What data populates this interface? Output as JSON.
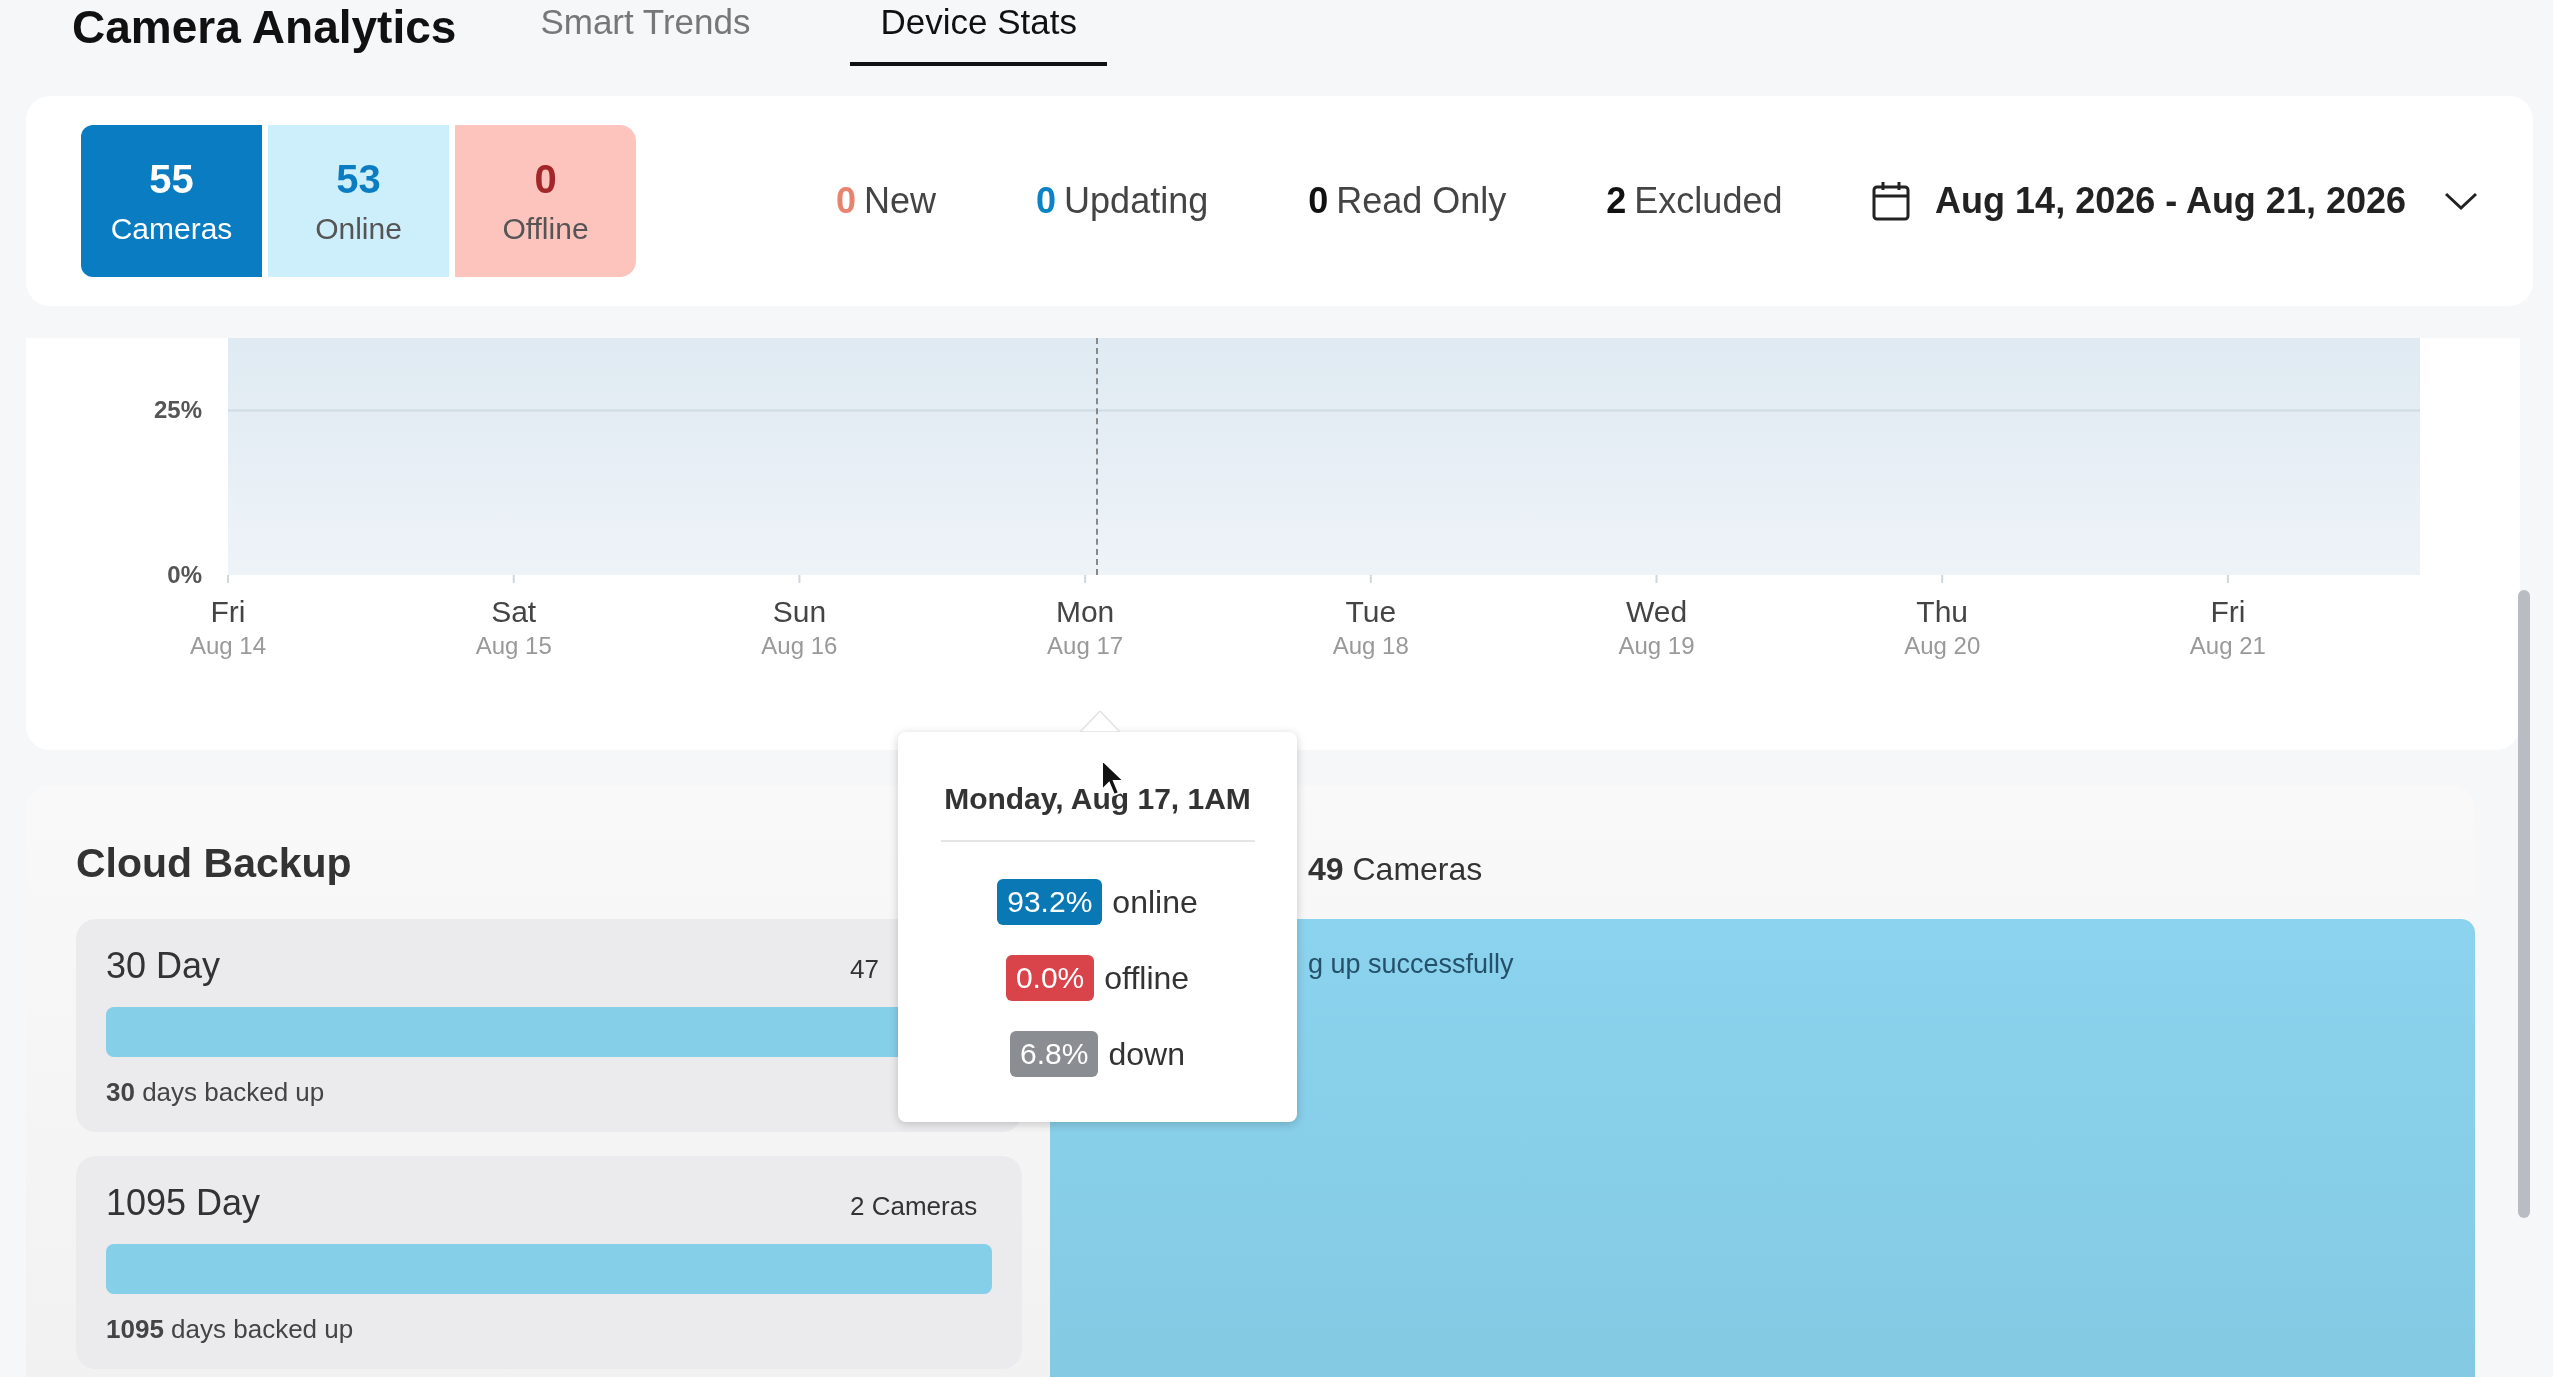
{
  "header": {
    "title": "Camera Analytics"
  },
  "tabs": [
    {
      "label": "Smart Trends",
      "selected": false
    },
    {
      "label": "Device Stats",
      "selected": true
    }
  ],
  "summary": {
    "tiles": [
      {
        "kind": "total",
        "value": "55",
        "label": "Cameras"
      },
      {
        "kind": "online",
        "value": "53",
        "label": "Online"
      },
      {
        "kind": "offline",
        "value": "0",
        "label": "Offline"
      }
    ],
    "counts": [
      {
        "value": "0",
        "label": "New",
        "color": "#e8836f"
      },
      {
        "value": "0",
        "label": "Updating",
        "color": "#0a84c6"
      },
      {
        "value": "0",
        "label": "Read Only",
        "color": "#111111"
      },
      {
        "value": "2",
        "label": "Excluded",
        "color": "#111111"
      }
    ],
    "date_range": "Aug 14, 2026 - Aug 21, 2026"
  },
  "uptime_chart": {
    "chart_data": {
      "type": "area",
      "categories": [
        "Fri",
        "Sat",
        "Sun",
        "Mon",
        "Tue",
        "Wed",
        "Thu",
        "Fri"
      ],
      "ylim": [
        0,
        36
      ],
      "yticks": [
        {
          "value": 0,
          "label": "0%"
        },
        {
          "value": 25,
          "label": "25%"
        }
      ],
      "ref_lines": [
        {
          "axis": "y",
          "value": 25
        }
      ]
    },
    "category_dates": [
      "Aug 14",
      "Aug 15",
      "Aug 16",
      "Aug 17",
      "Aug 18",
      "Aug 19",
      "Aug 20",
      "Aug 21"
    ]
  },
  "tooltip": {
    "title": "Monday, Aug 17, 1AM",
    "items": [
      {
        "value": "93.2%",
        "label": "online",
        "color": "#0a78b5"
      },
      {
        "value": "0.0%",
        "label": "offline",
        "color": "#d9434a"
      },
      {
        "value": "6.8%",
        "label": "down",
        "color": "#8a8d91"
      }
    ]
  },
  "cloud_backup": {
    "title": "Cloud Backup",
    "plans": [
      {
        "name": "30 Day",
        "cameras": "47",
        "level": 1,
        "note": "**30** days backed up"
      },
      {
        "name": "1095 Day",
        "cameras": "2 Cameras",
        "level": 1,
        "note": "**1095** days backed up"
      }
    ],
    "status": {
      "cameras": "**49** Cameras",
      "message": "g up successfully"
    }
  }
}
